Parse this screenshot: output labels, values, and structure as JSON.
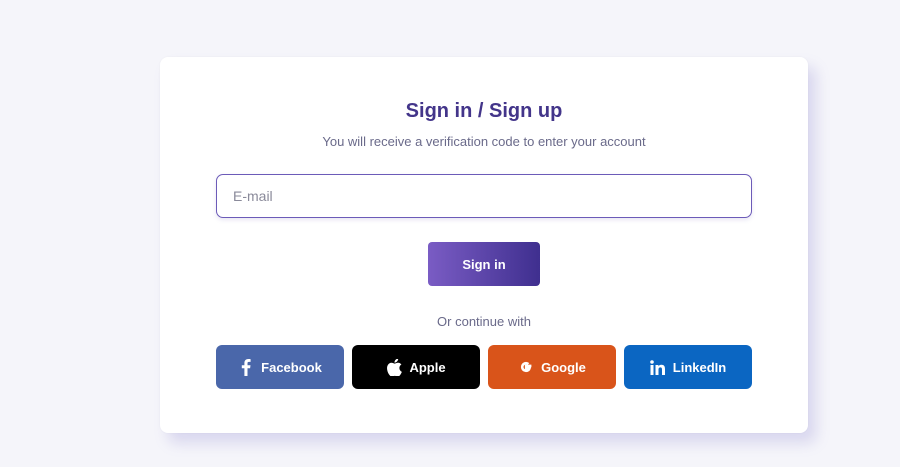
{
  "auth": {
    "title": "Sign in / Sign up",
    "subtitle": "You will receive a verification code to enter your account",
    "email_placeholder": "E-mail",
    "email_value": "",
    "signin_label": "Sign in",
    "divider_text": "Or continue with"
  },
  "social": [
    {
      "label": "Facebook",
      "icon": "facebook-icon",
      "color": "#4a67aa"
    },
    {
      "label": "Apple",
      "icon": "apple-icon",
      "color": "#000000"
    },
    {
      "label": "Google",
      "icon": "google-icon",
      "color": "#d9541a"
    },
    {
      "label": "LinkedIn",
      "icon": "linkedin-icon",
      "color": "#0b66c2"
    }
  ],
  "colors": {
    "accent": "#43358a",
    "button_gradient_start": "#7a5cc4",
    "button_gradient_end": "#3f2f8f",
    "background": "#f5f5fa"
  }
}
